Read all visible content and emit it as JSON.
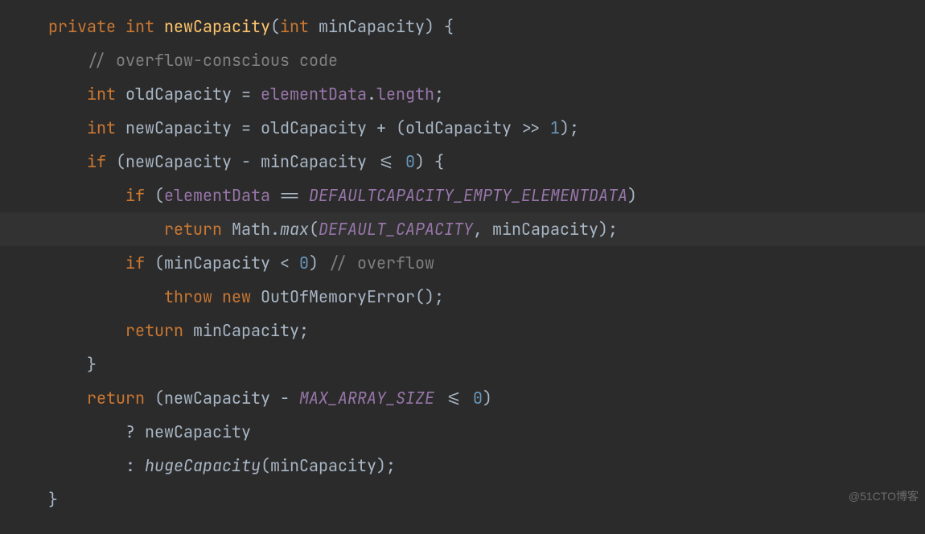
{
  "watermark": "@51CTO博客",
  "kw": {
    "private": "private",
    "int": "int",
    "if": "if",
    "return": "return",
    "throw": "throw",
    "new": "new"
  },
  "id": {
    "newCapacity_fn": "newCapacity",
    "minCapacity": "minCapacity",
    "oldCapacity": "oldCapacity",
    "newCapacity": "newCapacity",
    "elementData": "elementData",
    "length": "length",
    "Math": "Math",
    "max": "max",
    "OutOfMemoryError": "OutOfMemoryError",
    "hugeCapacity": "hugeCapacity"
  },
  "const": {
    "DEFAULTCAPACITY_EMPTY_ELEMENTDATA": "DEFAULTCAPACITY_EMPTY_ELEMENTDATA",
    "DEFAULT_CAPACITY": "DEFAULT_CAPACITY",
    "MAX_ARRAY_SIZE": "MAX_ARRAY_SIZE"
  },
  "num": {
    "zero": "0",
    "one": "1"
  },
  "cm": {
    "overflowConscious": "// overflow-conscious code",
    "overflow": "// overflow"
  },
  "punct": {
    "lpar": "(",
    "rpar": ")",
    "lbrace": " {",
    "rbrace": "}",
    "eq": " = ",
    "semi": ";",
    "dot": ".",
    "plus": " + ",
    "shr": " >> ",
    "minus": " - ",
    "leq": " <= ",
    "deq": " == ",
    "lt": " < ",
    "comma": ", ",
    "q": "? ",
    "colon": ": ",
    "emptyparens": "()"
  },
  "sp": {
    "s1": "    ",
    "s2": "        ",
    "s3": "            "
  }
}
